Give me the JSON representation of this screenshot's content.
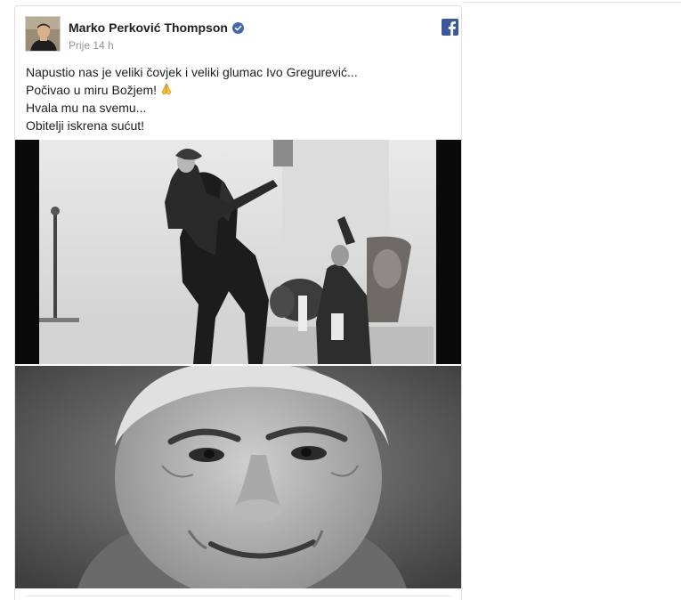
{
  "post": {
    "author": "Marko Perković Thompson",
    "verified": true,
    "time": "Prije 14 h",
    "text_lines": [
      "Napustio nas je veliki čovjek i veliki glumac Ivo Gregurević...",
      "Počivao u miru Božjem!",
      "Hvala mu na svemu...",
      "Obitelji iskrena sućut!"
    ],
    "icons": {
      "verified": "verified-badge-icon",
      "platform": "facebook-icon",
      "emoji": "praying-hands-emoji"
    },
    "photos": [
      {
        "alt": "black-and-white film still: rider on horse and man waving"
      },
      {
        "alt": "black-and-white close-up portrait of a smiling man"
      }
    ]
  },
  "colors": {
    "text": "#1c1e21",
    "muted": "#90949c",
    "verified": "#4267b2",
    "facebook": "#3b5998",
    "border": "#dddfe2"
  }
}
